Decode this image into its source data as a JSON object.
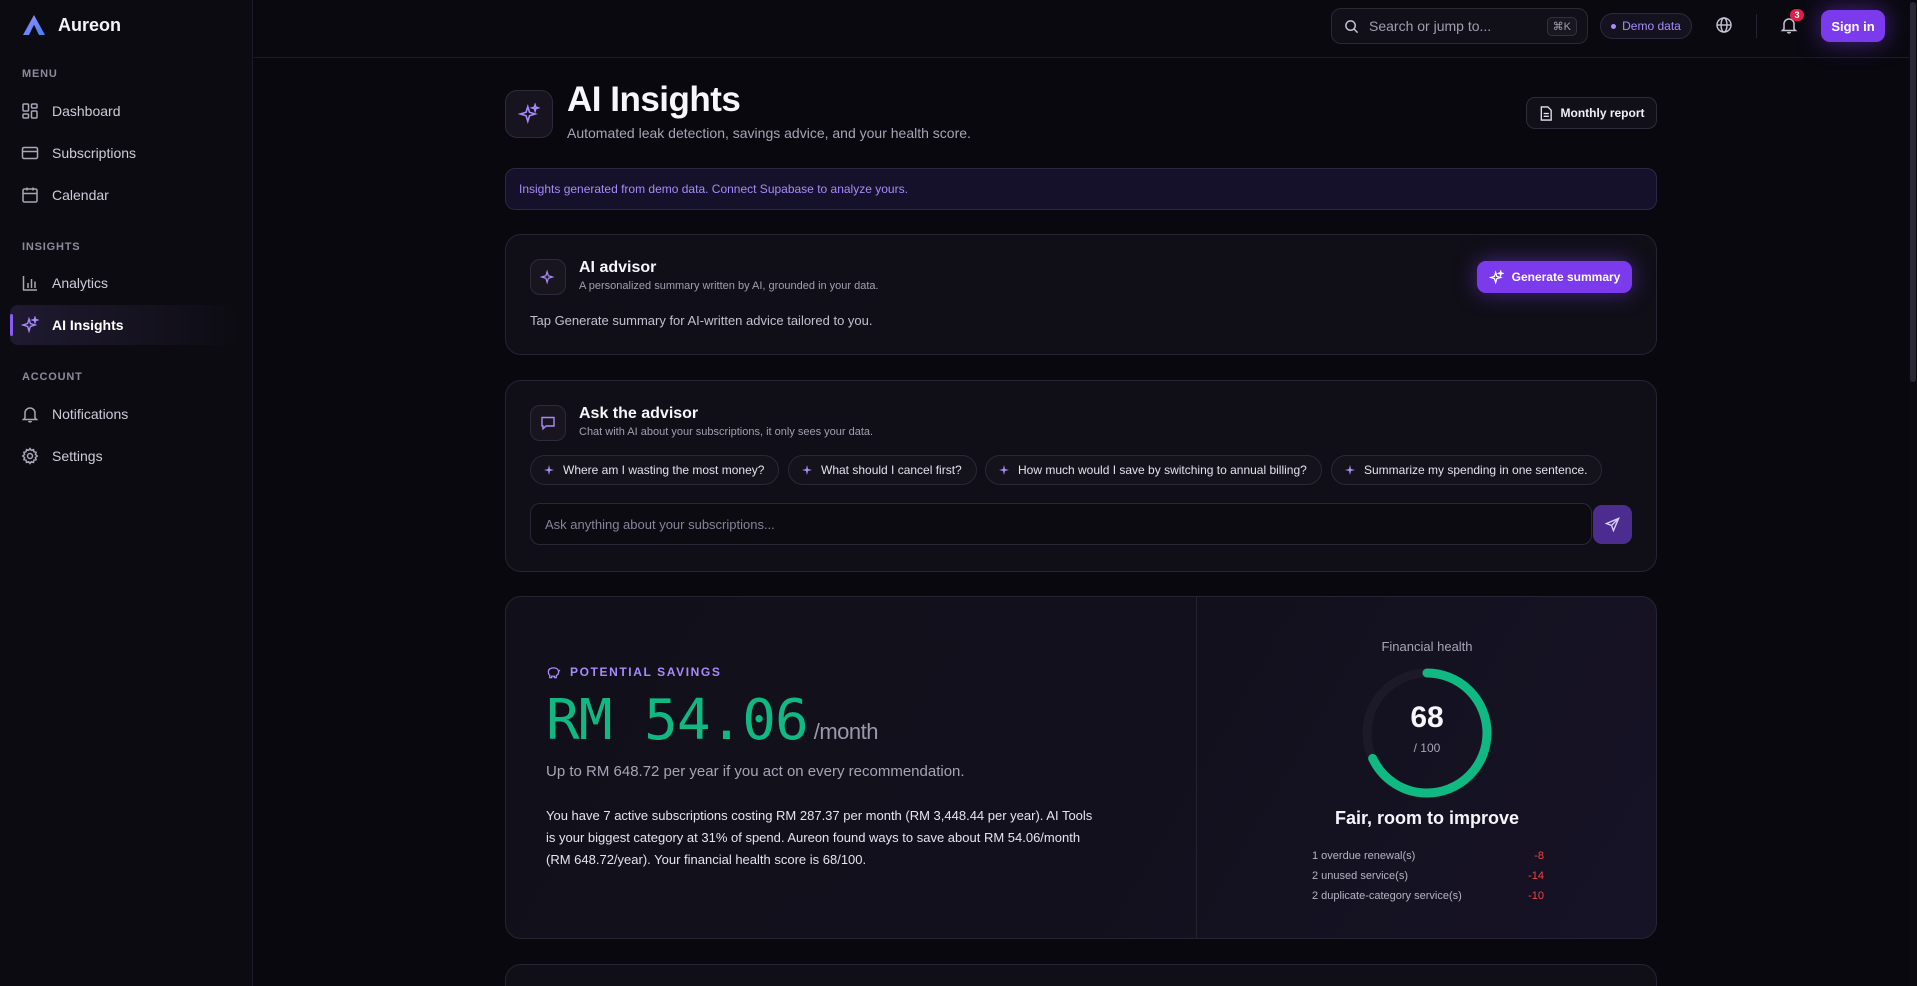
{
  "brand": {
    "name": "Aureon"
  },
  "sidebar": {
    "sections": {
      "menu": "MENU",
      "insights": "INSIGHTS",
      "account": "ACCOUNT"
    },
    "items": {
      "dashboard": "Dashboard",
      "subscriptions": "Subscriptions",
      "calendar": "Calendar",
      "analytics": "Analytics",
      "ai_insights": "AI Insights",
      "notifications": "Notifications",
      "settings": "Settings"
    },
    "active": "ai_insights"
  },
  "topbar": {
    "search_placeholder": "Search or jump to...",
    "search_shortcut": "⌘K",
    "demo_label": "Demo data",
    "notification_count": "3",
    "signin_label": "Sign in"
  },
  "page": {
    "title": "AI Insights",
    "subtitle": "Automated leak detection, savings advice, and your health score.",
    "report_button": "Monthly report",
    "banner": "Insights generated from demo data. Connect Supabase to analyze yours."
  },
  "advisor": {
    "title": "AI advisor",
    "subtitle": "A personalized summary written by AI, grounded in your data.",
    "button": "Generate summary",
    "hint": "Tap Generate summary for AI-written advice tailored to you."
  },
  "ask": {
    "title": "Ask the advisor",
    "subtitle": "Chat with AI about your subscriptions, it only sees your data.",
    "chips": [
      "Where am I wasting the most money?",
      "What should I cancel first?",
      "How much would I save by switching to annual billing?",
      "Summarize my spending in one sentence."
    ],
    "input_placeholder": "Ask anything about your subscriptions..."
  },
  "savings": {
    "label": "POTENTIAL SAVINGS",
    "amount": "RM 54.06",
    "period": "/month",
    "yearly": "Up to RM 648.72 per year if you act on every recommendation.",
    "summary": "You have 7 active subscriptions costing RM 287.37 per month (RM 3,448.44 per year). AI Tools is your biggest category at 31% of spend. Aureon found ways to save about RM 54.06/month (RM 648.72/year). Your financial health score is 68/100."
  },
  "health": {
    "label": "Financial health",
    "score": 68,
    "score_text": "68",
    "max_text": "/ 100",
    "status": "Fair, room to improve",
    "penalties": [
      {
        "label": "1 overdue renewal(s)",
        "value": "-8"
      },
      {
        "label": "2 unused service(s)",
        "value": "-14"
      },
      {
        "label": "2 duplicate-category service(s)",
        "value": "-10"
      }
    ],
    "colors": {
      "ring": "#10b981",
      "track": "#1c1a29",
      "penalty": "#ef4444"
    }
  },
  "theme": {
    "accent": "#7c3aed",
    "accent_light": "#a78bfa",
    "success": "#10b981"
  }
}
